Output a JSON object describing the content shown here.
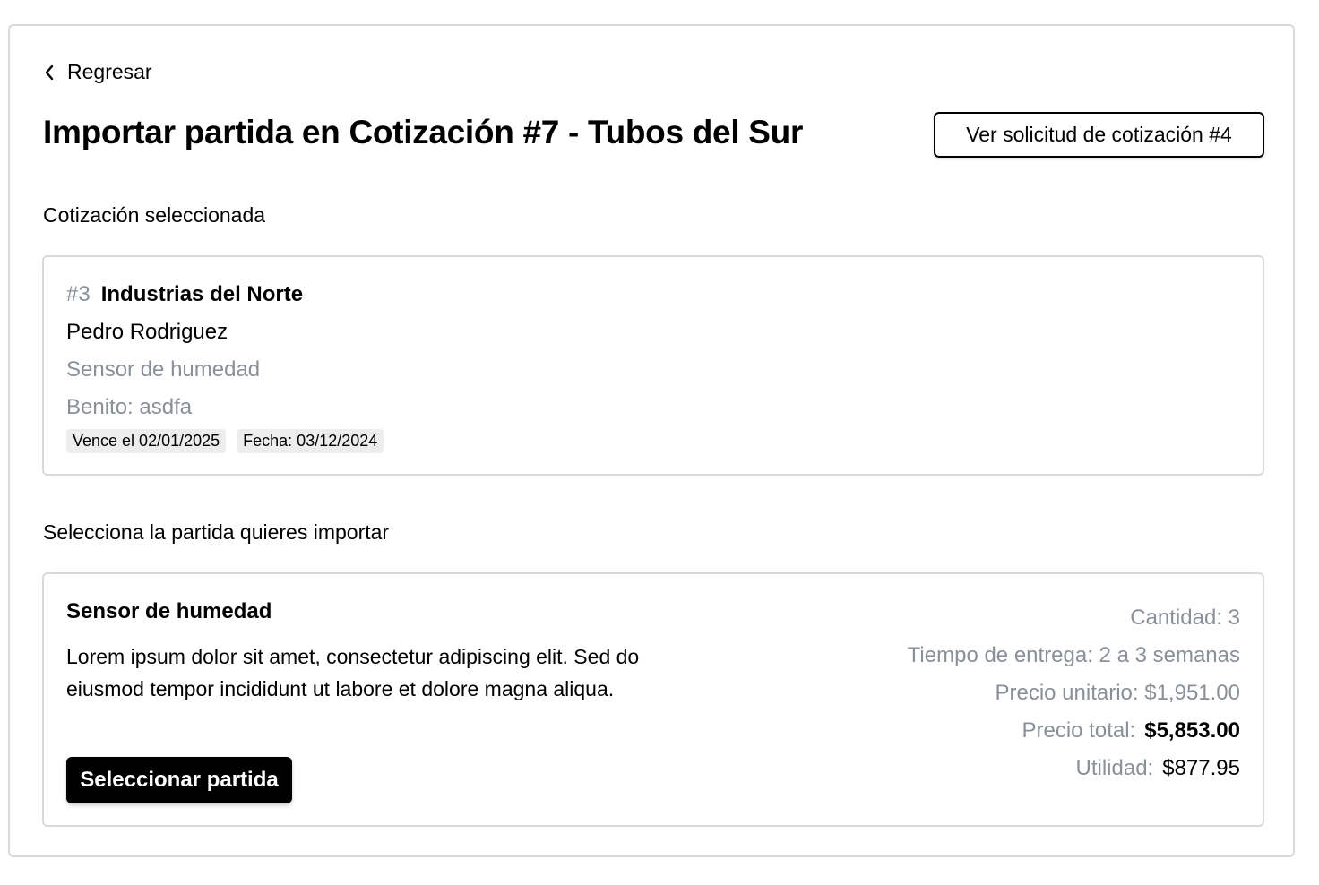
{
  "nav": {
    "back_label": "Regresar"
  },
  "header": {
    "title": "Importar partida en Cotización #7 - Tubos del Sur",
    "view_request_label": "Ver solicitud de cotización #4"
  },
  "selected_quote": {
    "section_label": "Cotización seleccionada",
    "id": "#3",
    "company": "Industrias del Norte",
    "contact": "Pedro Rodriguez",
    "product": "Sensor de humedad",
    "note": "Benito: asdfa",
    "badges": [
      "Vence el 02/01/2025",
      "Fecha: 03/12/2024"
    ]
  },
  "item_picker": {
    "section_label": "Selecciona la partida quieres importar",
    "item": {
      "name": "Sensor de humedad",
      "description": "Lorem ipsum dolor sit amet, consectetur adipiscing elit. Sed do eiusmod tempor incididunt ut labore et dolore magna aliqua.",
      "select_label": "Seleccionar partida",
      "quantity": "Cantidad: 3",
      "lead_time": "Tiempo de entrega: 2 a 3 semanas",
      "unit_price": "Precio unitario: $1,951.00",
      "total_price_label": "Precio total:",
      "total_price_value": "$5,853.00",
      "profit_label": "Utilidad:",
      "profit_value": "$877.95"
    }
  },
  "colors": {
    "muted_text": "#8a8f98",
    "border": "#d9d9d9",
    "badge_bg": "#ededed",
    "primary_button": "#000000"
  },
  "icons": {
    "back": "chevron-left-icon"
  }
}
